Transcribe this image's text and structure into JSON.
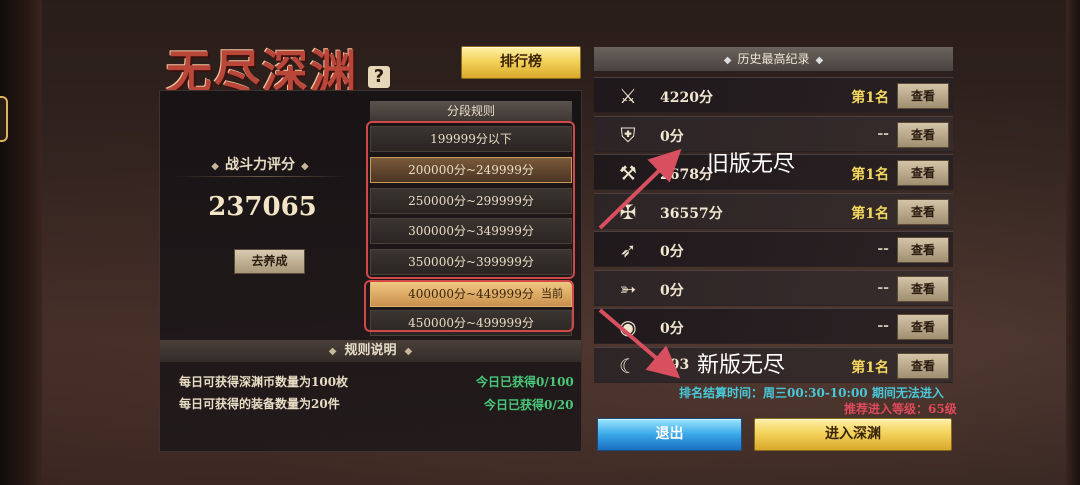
{
  "title": "无尽深渊",
  "help_icon": "?",
  "rank_button": "排行榜",
  "power": {
    "label": "战斗力评分",
    "value": "237065",
    "train_button": "去养成"
  },
  "segments": {
    "header": "分段规则",
    "rows": [
      "199999分以下",
      "200000分~249999分",
      "250000分~299999分",
      "300000分~349999分",
      "350000分~399999分",
      "400000分~449999分",
      "450000分~499999分"
    ],
    "current_tag": "当前"
  },
  "rules": {
    "header": "规则说明",
    "items": [
      {
        "text": "每日可获得深渊币数量为100枚",
        "status": "今日已获得0/100"
      },
      {
        "text": "每日可获得的装备数量为20件",
        "status": "今日已获得0/20"
      }
    ]
  },
  "history": {
    "header": "历史最高纪录",
    "rows": [
      {
        "icon": "crossed-axes-icon",
        "glyph": "⚔",
        "score": "4220分",
        "rank": "第1名",
        "view": "查看"
      },
      {
        "icon": "shield-crest-icon",
        "glyph": "⛨",
        "score": "0分",
        "rank": "--",
        "view": "查看"
      },
      {
        "icon": "battle-axe-icon",
        "glyph": "⚒",
        "score": "2678分",
        "rank": "第1名",
        "view": "查看"
      },
      {
        "icon": "winged-sword-icon",
        "glyph": "✠",
        "score": "36557分",
        "rank": "第1名",
        "view": "查看"
      },
      {
        "icon": "spear-icon",
        "glyph": "➶",
        "score": "0分",
        "rank": "--",
        "view": "查看"
      },
      {
        "icon": "bow-icon",
        "glyph": "➳",
        "score": "0分",
        "rank": "--",
        "view": "查看"
      },
      {
        "icon": "eye-emblem-icon",
        "glyph": "◉",
        "score": "0分",
        "rank": "--",
        "view": "查看"
      },
      {
        "icon": "scythe-icon",
        "glyph": "☾",
        "score": "293",
        "rank": "第1名",
        "view": "查看"
      }
    ]
  },
  "annotations": {
    "old": "旧版无尽",
    "new": "新版无尽"
  },
  "schedule_text": "排名结算时间：周三00:30-10:00 期间无法进入",
  "level_text": "推荐进入等级：65级",
  "exit_button": "退出",
  "enter_button": "进入深渊",
  "colors": {
    "title_red": "#b8473a",
    "gold_button": "#f4d35c",
    "blue_button": "#3aa8e8",
    "status_green": "#48c878",
    "time_cyan": "#48c8d8",
    "level_red": "#e04a5a",
    "rank_gold": "#f4d860",
    "annotation_box": "#d04848",
    "arrow": "#d85060"
  }
}
